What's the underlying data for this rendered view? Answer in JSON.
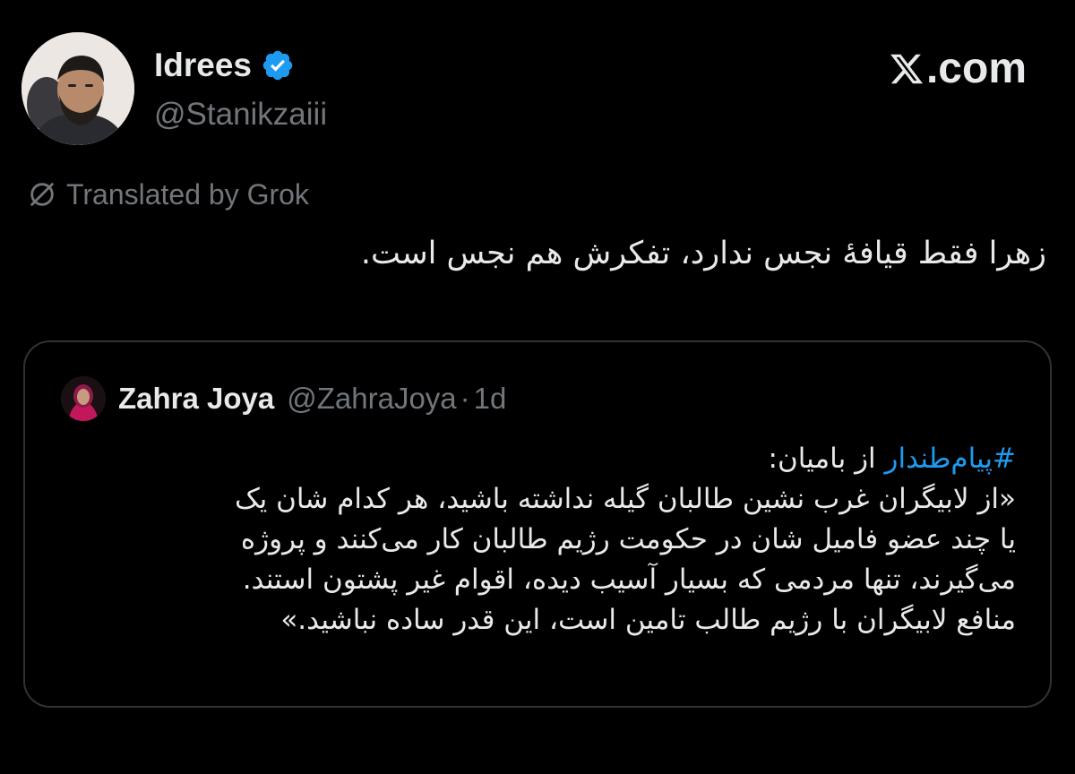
{
  "author": {
    "display_name": "Idrees",
    "handle": "@Stanikzaiii",
    "verified": true,
    "verified_color": "#1d9bf0"
  },
  "brand": {
    "label": ".com",
    "icon": "x-logo-icon"
  },
  "translation": {
    "label": "Translated by Grok",
    "icon": "grok-icon"
  },
  "tweet": {
    "text": "زهرا فقط قیافۀ نجس ندارد، تفکرش هم نجس است."
  },
  "quoted": {
    "display_name": "Zahra Joya",
    "handle": "@ZahraJoya",
    "separator": "·",
    "time": "1d",
    "hashtag": "#پیام‌طندار",
    "line1_rest": " از بامیان:",
    "line2": "«از لابیگران غرب نشین طالبان گیله نداشته باشید، هر کدام شان یک",
    "line3": "یا چند عضو فامیل شان در حکومت رژیم طالبان کار می‌کنند و پروژه",
    "line4": "می‌گیرند، تنها مردمی که بسیار آسیب دیده، اقوام غیر پشتون استند.",
    "line5": "منافع لابیگران با رژیم طالب تامین است، این قدر ساده نباشید.»"
  },
  "colors": {
    "background": "#000000",
    "text": "#e7e9ea",
    "muted": "#71767b",
    "link": "#1d9bf0",
    "border": "#2f3336"
  }
}
